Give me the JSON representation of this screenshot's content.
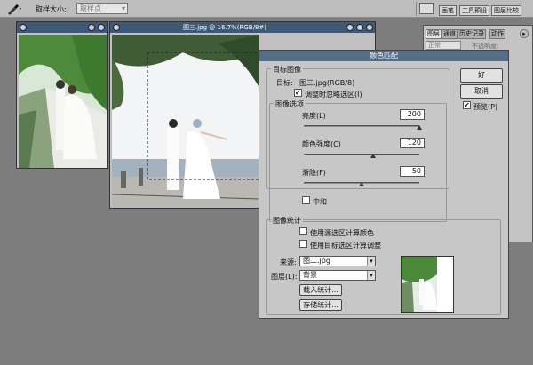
{
  "optionbar": {
    "tool_icon": "eyedropper-icon",
    "sample_size_label": "取样大小:",
    "sample_size_value": "取样点"
  },
  "palette_well": {
    "tabs": [
      "画笔",
      "工具预设",
      "图层比较"
    ]
  },
  "right_panel": {
    "tabs": [
      "图层",
      "通道",
      "历史记录",
      "动作"
    ],
    "blend_mode": "正常",
    "opacity_label": "不透明度:"
  },
  "doc_main": {
    "title": "图三.jpg @ 16.7%(RGB/8#)"
  },
  "dialog": {
    "title": "颜色匹配",
    "target_group_title": "目标图像",
    "target_label": "目标:",
    "target_value": "图三.jpg(RGB/8)",
    "ignore_selection_label": "调整时忽略选区(I)",
    "ignore_selection_checked": true,
    "options_group_title": "图像选项",
    "luminance_label": "亮度(L)",
    "luminance_value": "200",
    "luminance_level": 1.0,
    "color_intensity_label": "颜色强度(C)",
    "color_intensity_value": "120",
    "color_intensity_level": 0.6,
    "fade_label": "渐隐(F)",
    "fade_value": "50",
    "fade_level": 0.5,
    "neutralize_label": "中和",
    "stats_group_title": "图像统计",
    "use_sel_source_label": "使用源选区计算颜色",
    "use_sel_target_label": "使用目标选区计算调整",
    "source_label": "来源:",
    "source_value": "图二.jpg",
    "layer_label": "图层(L):",
    "layer_value": "背景",
    "load_stats_label": "载入统计...",
    "save_stats_label": "存储统计...",
    "ok_label": "好",
    "cancel_label": "取消",
    "preview_label": "预览(P)",
    "preview_checked": true
  }
}
